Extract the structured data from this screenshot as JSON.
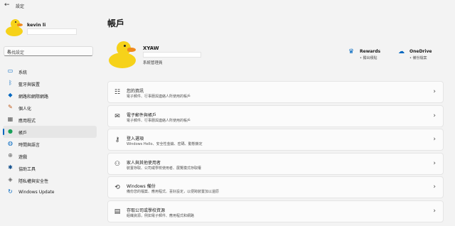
{
  "window": {
    "back_glyph": "←",
    "title": "設定"
  },
  "user": {
    "name": "kevin li"
  },
  "search": {
    "placeholder": "尋找設定",
    "icon": "search-icon"
  },
  "sidebar": {
    "items": [
      {
        "label": "系統",
        "icon": "display-icon",
        "glyph": "▭",
        "color": "#0067c0"
      },
      {
        "label": "藍牙與裝置",
        "icon": "bluetooth-icon",
        "glyph": "ᛒ",
        "color": "#0067c0"
      },
      {
        "label": "網路和網際網路",
        "icon": "wifi-icon",
        "glyph": "◆",
        "color": "#0067c0"
      },
      {
        "label": "個人化",
        "icon": "brush-icon",
        "glyph": "✎",
        "color": "#c05a18"
      },
      {
        "label": "應用程式",
        "icon": "apps-icon",
        "glyph": "▦",
        "color": "#555555"
      },
      {
        "label": "帳戶",
        "icon": "person-icon",
        "glyph": "●",
        "color": "#1aa05a",
        "active": true
      },
      {
        "label": "時間與語言",
        "icon": "globe-clock-icon",
        "glyph": "◍",
        "color": "#0067c0"
      },
      {
        "label": "遊戲",
        "icon": "gamepad-icon",
        "glyph": "⊕",
        "color": "#666666"
      },
      {
        "label": "協助工具",
        "icon": "accessibility-icon",
        "glyph": "✱",
        "color": "#0a4a8a"
      },
      {
        "label": "隱私權與安全性",
        "icon": "shield-icon",
        "glyph": "◈",
        "color": "#666666"
      },
      {
        "label": "Windows Update",
        "icon": "update-icon",
        "glyph": "↻",
        "color": "#0067c0"
      }
    ]
  },
  "main": {
    "title": "帳戶",
    "account": {
      "name": "XYAW",
      "role": "系統管理員"
    },
    "services": [
      {
        "title": "Rewards",
        "subtitle": "• 獨出積點",
        "icon": "rewards-icon",
        "glyph": "♛",
        "color": "#0067c0"
      },
      {
        "title": "OneDrive",
        "subtitle": "• 備份檔案",
        "icon": "onedrive-icon",
        "glyph": "☁",
        "color": "#0067c0"
      }
    ],
    "cards": [
      {
        "title": "您的資訊",
        "subtitle": "電子郵件、行事曆與連絡人所使用的帳戶",
        "icon": "your-info-icon",
        "glyph": "☷"
      },
      {
        "title": "電子郵件與帳戶",
        "subtitle": "電子郵件、行事曆與連絡人所使用的帳戶",
        "icon": "mail-icon",
        "glyph": "✉"
      },
      {
        "title": "登入選項",
        "subtitle": "Windows Hello、安全性金鑰、密碼、動態鎖定",
        "icon": "key-icon",
        "glyph": "⚷"
      },
      {
        "title": "家人與其他使用者",
        "subtitle": "裝置存取、公司或學校使用者、展覽模式存取權",
        "icon": "family-icon",
        "glyph": "⚇"
      },
      {
        "title": "Windows 備份",
        "subtitle": "備份您的檔案、應用程式、喜好設定，以便跨裝置加以還原",
        "icon": "backup-icon",
        "glyph": "⟲"
      },
      {
        "title": "存取公司或學校資源",
        "subtitle": "組織資源，例如電子郵件、應用程式和網路",
        "icon": "briefcase-icon",
        "glyph": "▤"
      }
    ],
    "chevron": "›"
  }
}
